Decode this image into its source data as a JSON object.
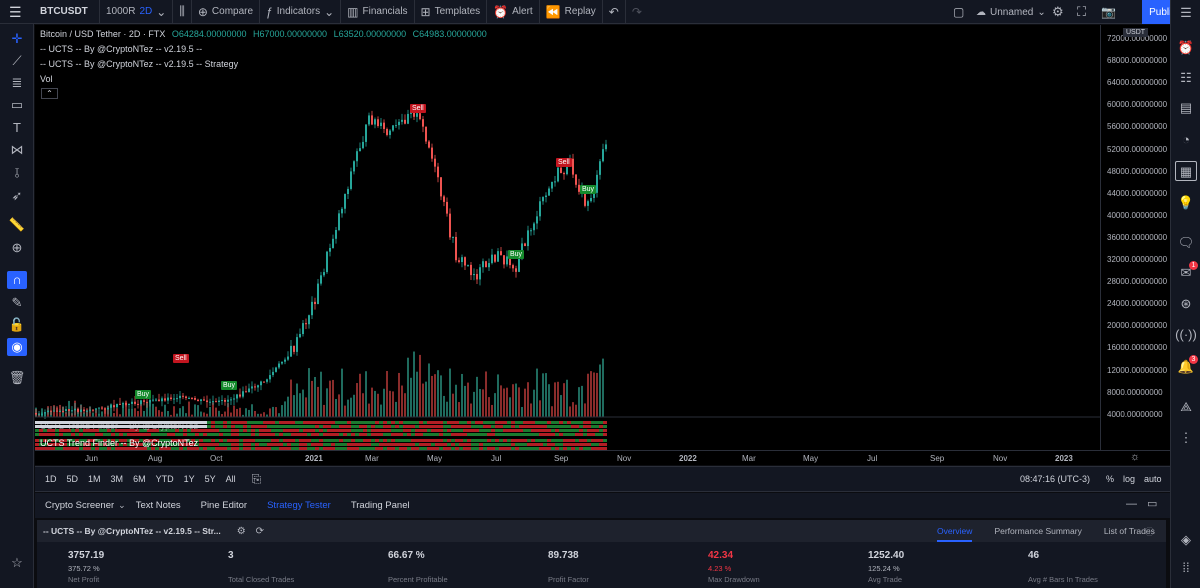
{
  "toolbar": {
    "symbol": "BTCUSDT",
    "interval_value": "1000R",
    "interval_resolution": "2D",
    "compare": "Compare",
    "indicators": "Indicators",
    "financials": "Financials",
    "templates": "Templates",
    "alert": "Alert",
    "replay": "Replay",
    "layout_name": "Unnamed",
    "publish": "Publish"
  },
  "legend": {
    "title": "Bitcoin / USD Tether · 2D · FTX",
    "ohlc": {
      "o": "O64284.00000000",
      "h": "H67000.00000000",
      "l": "L63520.00000000",
      "c": "C64983.00000000"
    },
    "indicator1": "-- UCTS -- By @CryptoNTez -- v2.19.5 --",
    "indicator2": "-- UCTS -- By @CryptoNTez -- v2.19.5 -- Strategy",
    "indicator3": "Vol"
  },
  "trend_finder_label": "UCTS Trend Finder -- By @CryptoNTez",
  "trend_finder_label2": "UCTS Trend Finder -- By @CryptoNTez",
  "signals": {
    "sell": "Sell",
    "buy": "Buy"
  },
  "price_axis": {
    "currency_badge": "USDT",
    "labels": [
      "72000.00000000",
      "68000.00000000",
      "64000.00000000",
      "60000.00000000",
      "56000.00000000",
      "52000.00000000",
      "48000.00000000",
      "44000.00000000",
      "40000.00000000",
      "36000.00000000",
      "32000.00000000",
      "28000.00000000",
      "24000.00000000",
      "20000.00000000",
      "16000.00000000",
      "12000.00000000",
      "8000.00000000",
      "4000.00000000"
    ]
  },
  "time_axis": [
    "Jun",
    "Aug",
    "Oct",
    "2021",
    "Mar",
    "May",
    "Jul",
    "Sep",
    "Nov",
    "2022",
    "Mar",
    "May",
    "Jul",
    "Sep",
    "Nov",
    "2023"
  ],
  "range_bar": {
    "ranges": [
      "1D",
      "5D",
      "1M",
      "3M",
      "6M",
      "YTD",
      "1Y",
      "5Y",
      "All"
    ],
    "time": "08:47:16 (UTC-3)",
    "pct": "%",
    "log": "log",
    "auto": "auto"
  },
  "panel": {
    "tabs": [
      "Crypto Screener",
      "Text Notes",
      "Pine Editor",
      "Strategy Tester",
      "Trading Panel"
    ],
    "active_tab": "Strategy Tester",
    "strategy_name": "-- UCTS -- By @CryptoNTez -- v2.19.5 -- Str...",
    "sub_tabs": [
      "Overview",
      "Performance Summary",
      "List of Trades"
    ],
    "metrics": [
      {
        "value": "3757.19",
        "sub": "375.72 %",
        "label": "Net Profit"
      },
      {
        "value": "3",
        "sub": "",
        "label": "Total Closed Trades"
      },
      {
        "value": "66.67 %",
        "sub": "",
        "label": "Percent Profitable"
      },
      {
        "value": "89.738",
        "sub": "",
        "label": "Profit Factor"
      },
      {
        "value": "42.34",
        "sub": "4.23 %",
        "label": "Max Drawdown"
      },
      {
        "value": "1252.40",
        "sub": "125.24 %",
        "label": "Avg Trade"
      },
      {
        "value": "46",
        "sub": "",
        "label": "Avg # Bars In Trades"
      }
    ]
  },
  "right_sidebar": {
    "badge1": "1",
    "badge2": "3"
  },
  "colors": {
    "bull": "#26a69a",
    "bear": "#ef5350",
    "accent": "#2962ff"
  }
}
